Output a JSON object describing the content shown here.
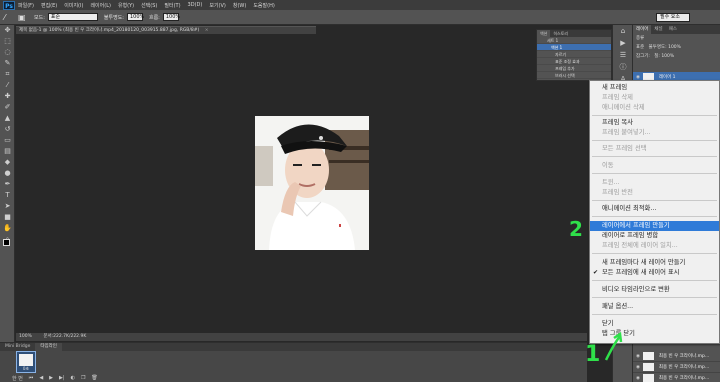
{
  "app": {
    "logo": "Ps",
    "menus": [
      "파일(F)",
      "편집(E)",
      "이미지(I)",
      "레이어(L)",
      "유형(Y)",
      "선택(S)",
      "필터(T)",
      "3D(D)",
      "보기(V)",
      "창(W)",
      "도움말(H)"
    ]
  },
  "options": {
    "mode_label": "모드:",
    "mode_value": "표준",
    "opacity_label": "불투명도:",
    "opacity_value": "100%",
    "flow_label": "흐름:",
    "flow_value": "100%",
    "workspace": "필수 요소"
  },
  "document": {
    "tab_title": "제목 없음-1 @ 100% (최용 빈 우 크라이나.mp4_20180120_003915.887.jpg, RGB/8#)",
    "close_glyph": "×"
  },
  "status": {
    "zoom": "100%",
    "doc_size": "문서:222.7K/222.9K"
  },
  "timeline": {
    "tabs": [
      "Mini Bridge",
      "타임라인"
    ],
    "frame_number": "1",
    "frame_delay": "0초",
    "loop": "한 번"
  },
  "actions_panel": {
    "tabs": [
      "액션",
      "히스토리"
    ],
    "rows": [
      "세트 1",
      "액션 1",
      "자르기",
      "표준 조정 효과",
      "프레임 추가",
      "브러시 선택"
    ],
    "selected_index": 1
  },
  "layers_panel": {
    "tabs": [
      "레이어",
      "채널",
      "패스"
    ],
    "kind_label": "종류",
    "blend_mode": "표준",
    "opacity": "불투명도: 100%",
    "lock_label": "잠그기:",
    "fill": "칠: 100%",
    "layers": [
      "레이어 1",
      "최용 빈 우 크라이나.mp...",
      "최용 빈 우 크라이나.mp...",
      "최용 빈 우 크라이나.mp..."
    ]
  },
  "flyout_menu": {
    "items": [
      {
        "label": "새 프레임",
        "disabled": false
      },
      {
        "label": "프레임 삭제",
        "disabled": true
      },
      {
        "label": "애니메이션 삭제",
        "disabled": true
      },
      {
        "label": "프레임 복사",
        "disabled": false
      },
      {
        "label": "프레임 붙여넣기...",
        "disabled": true
      },
      {
        "label": "모든 프레임 선택",
        "disabled": true
      },
      {
        "label": "이동",
        "disabled": true
      },
      {
        "label": "트윈...",
        "disabled": true
      },
      {
        "label": "프레임 반전",
        "disabled": true
      },
      {
        "label": "애니메이션 최적화...",
        "disabled": false
      },
      {
        "label": "레이어에서 프레임 만들기",
        "disabled": false,
        "highlighted": true
      },
      {
        "label": "레이어로 프레임 병합",
        "disabled": false
      },
      {
        "label": "프레임 전체에 레이어 일치...",
        "disabled": true
      },
      {
        "label": "새 프레임마다 새 레이어 만들기",
        "disabled": false
      },
      {
        "label": "모든 프레임에 새 레이어 표시",
        "disabled": false,
        "checked": true
      },
      {
        "label": "비디오 타임라인으로 변환",
        "disabled": false
      },
      {
        "label": "패널 옵션...",
        "disabled": false
      },
      {
        "label": "닫기",
        "disabled": false
      },
      {
        "label": "탭 그룹 닫기",
        "disabled": false
      }
    ],
    "check_glyph": "✔"
  },
  "annotations": {
    "step_one": "1",
    "step_two": "2",
    "color": "#2fe04a"
  },
  "colors": {
    "menu_highlight": "#2f7bd8",
    "workspace_bg": "#282828",
    "panel_bg": "#535353"
  }
}
